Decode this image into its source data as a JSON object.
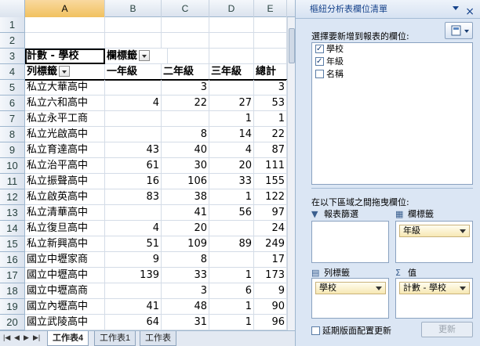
{
  "columns": [
    "A",
    "B",
    "C",
    "D",
    "E"
  ],
  "pivot": {
    "count_label": "計數 - 學校",
    "col_labels_header": "欄標籤",
    "row_labels_header": "列標籤",
    "grade_headers": [
      "一年級",
      "二年級",
      "三年級",
      "總計"
    ]
  },
  "rows": [
    {
      "n": "1",
      "name": "",
      "v": [
        "",
        "",
        "",
        ""
      ]
    },
    {
      "n": "2",
      "name": "",
      "v": [
        "",
        "",
        "",
        ""
      ]
    },
    {
      "n": "5",
      "name": "私立大華高中",
      "v": [
        "",
        "3",
        "",
        "3"
      ]
    },
    {
      "n": "6",
      "name": "私立六和高中",
      "v": [
        "4",
        "22",
        "27",
        "53"
      ]
    },
    {
      "n": "7",
      "name": "私立永平工商",
      "v": [
        "",
        "",
        "1",
        "1"
      ]
    },
    {
      "n": "8",
      "name": "私立光啟高中",
      "v": [
        "",
        "8",
        "14",
        "22"
      ]
    },
    {
      "n": "9",
      "name": "私立育達高中",
      "v": [
        "43",
        "40",
        "4",
        "87"
      ]
    },
    {
      "n": "10",
      "name": "私立治平高中",
      "v": [
        "61",
        "30",
        "20",
        "111"
      ]
    },
    {
      "n": "11",
      "name": "私立振聲高中",
      "v": [
        "16",
        "106",
        "33",
        "155"
      ]
    },
    {
      "n": "12",
      "name": "私立啟英高中",
      "v": [
        "83",
        "38",
        "1",
        "122"
      ]
    },
    {
      "n": "13",
      "name": "私立清華高中",
      "v": [
        "",
        "41",
        "56",
        "97"
      ]
    },
    {
      "n": "14",
      "name": "私立復旦高中",
      "v": [
        "4",
        "20",
        "",
        "24"
      ]
    },
    {
      "n": "15",
      "name": "私立新興高中",
      "v": [
        "51",
        "109",
        "89",
        "249"
      ]
    },
    {
      "n": "16",
      "name": "國立中壢家商",
      "v": [
        "9",
        "8",
        "",
        "17"
      ]
    },
    {
      "n": "17",
      "name": "國立中壢高中",
      "v": [
        "139",
        "33",
        "1",
        "173"
      ]
    },
    {
      "n": "18",
      "name": "國立中壢高商",
      "v": [
        "",
        "3",
        "6",
        "9"
      ]
    },
    {
      "n": "19",
      "name": "國立內壢高中",
      "v": [
        "41",
        "48",
        "1",
        "90"
      ]
    },
    {
      "n": "20",
      "name": "國立武陵高中",
      "v": [
        "64",
        "31",
        "1",
        "96"
      ]
    }
  ],
  "row_numbers_header": [
    "3",
    "4"
  ],
  "tabs": [
    "工作表4",
    "工作表1",
    "工作表"
  ],
  "panel": {
    "title": "樞紐分析表欄位清單",
    "close": "×",
    "choose_label": "選擇要新增到報表的欄位:",
    "fields": [
      {
        "label": "學校",
        "checked": true
      },
      {
        "label": "年級",
        "checked": true
      },
      {
        "label": "名稱",
        "checked": false
      }
    ],
    "drag_label": "在以下區域之間拖曳欄位:",
    "report_filter": "報表篩選",
    "column_labels": "欄標籤",
    "row_labels": "列標籤",
    "values": "值",
    "column_field": "年級",
    "row_field": "學校",
    "value_field": "計數 - 學校",
    "defer_label": "延期版面配置更新",
    "update_button": "更新"
  }
}
